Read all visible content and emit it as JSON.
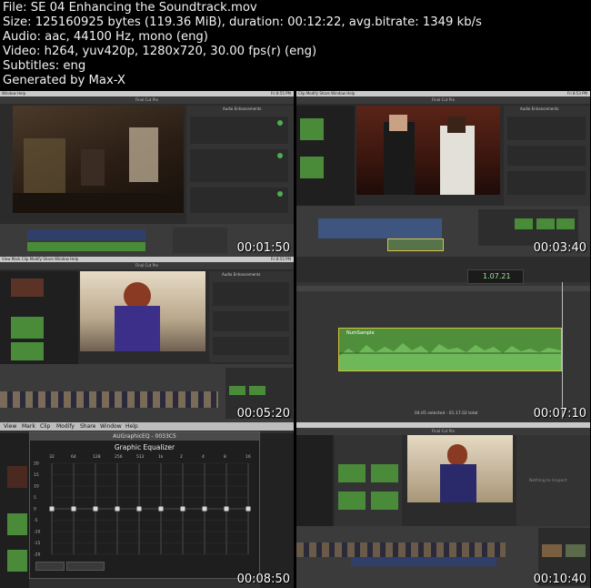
{
  "header": {
    "lines": [
      "File: SE 04 Enhancing the Soundtrack.mov",
      "Size: 125160925 bytes (119.36 MiB), duration: 00:12:22, avg.bitrate: 1349 kb/s",
      "Audio: aac, 44100 Hz, mono (eng)",
      "Video: h264, yuv420p, 1280x720, 30.00 fps(r) (eng)",
      "Subtitles: eng",
      "Generated by Max-X"
    ]
  },
  "thumbnails": [
    {
      "timestamp": "00:01:50",
      "app_title": "Final Cut Pro",
      "panel_title": "Audio Enhancements",
      "menu": "Window  Help",
      "clock": "Fri 8:55 PM"
    },
    {
      "timestamp": "00:03:40",
      "app_title": "Final Cut Pro",
      "panel_title": "Audio Enhancements",
      "menu": "Clip  Modify  Share  Window  Help",
      "clock": "Fri 8:53 PM"
    },
    {
      "timestamp": "00:05:20",
      "app_title": "Final Cut Pro",
      "panel_title": "Audio Enhancements",
      "menu": "View  Mark  Clip  Modify  Share  Window  Help",
      "clock": "Fri 8:55 PM"
    },
    {
      "timestamp": "00:07:10",
      "app_title": "Final Cut Pro",
      "clip_name": "NumSample",
      "timecode": "1.07.21",
      "status": "04.05 selected - 01.17.02 total"
    },
    {
      "timestamp": "00:08:50",
      "menu": [
        "View",
        "Mark",
        "Clip",
        "Modify",
        "Share",
        "Window",
        "Help"
      ],
      "eq_window_title": "AUGraphicEQ - 0033C5",
      "eq_heading": "Graphic Equalizer",
      "eq_freqs": [
        "32",
        "64",
        "128",
        "256",
        "512",
        "1k",
        "2",
        "4",
        "8",
        "16"
      ],
      "eq_db": [
        "20",
        "15",
        "10",
        "5",
        "0",
        "-5",
        "-10",
        "-15",
        "-20"
      ]
    },
    {
      "timestamp": "00:10:40",
      "app_title": "Final Cut Pro",
      "inspector_text": "Nothing to Inspect"
    }
  ]
}
